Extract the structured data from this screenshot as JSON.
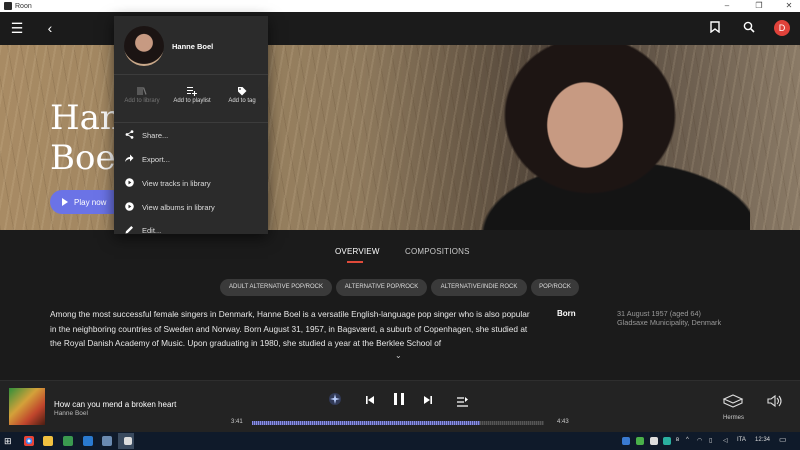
{
  "window": {
    "title": "Roon",
    "controls": [
      "–",
      "❐",
      "✕"
    ]
  },
  "appbar": {
    "menu_icon": "hamburger-icon",
    "back_icon": "chevron-left-icon",
    "bookmark_icon": "bookmark-icon",
    "search_icon": "search-icon",
    "profile_initial": "D",
    "profile_color": "#e0423a"
  },
  "hero": {
    "artist_name": "Hanne Boel",
    "play_label": "Play now",
    "accent": "#6b73e6"
  },
  "tabs": [
    {
      "label": "OVERVIEW",
      "active": true
    },
    {
      "label": "COMPOSITIONS",
      "active": false
    }
  ],
  "genres": [
    "ADULT ALTERNATIVE POP/ROCK",
    "ALTERNATIVE POP/ROCK",
    "ALTERNATIVE/INDIE ROCK",
    "POP/ROCK"
  ],
  "bio": "Among the most successful female singers in Denmark, Hanne Boel is a versatile English-language pop singer who is also popular in the neighboring countries of Sweden and Norway. Born August 31, 1957, in Bagsværd, a suburb of Copenhagen, she studied at the Royal Danish Academy of Music. Upon graduating in 1980, she studied a year at the Berklee School of",
  "born": {
    "label": "Born",
    "date": "31 August 1957 (aged 64)",
    "place": "Gladsaxe Municipality, Denmark"
  },
  "player": {
    "track_title": "How can you mend a broken heart",
    "track_artist": "Hanne Boel",
    "time_current": "3:41",
    "time_total": "4:43",
    "progress_fraction": 0.78,
    "zone_name": "Hermes"
  },
  "context_menu": {
    "artist_name": "Hanne Boel",
    "quick_actions": [
      {
        "label": "Add to library",
        "icon": "library-icon",
        "enabled": false
      },
      {
        "label": "Add to playlist",
        "icon": "playlist-add-icon",
        "enabled": true
      },
      {
        "label": "Add to tag",
        "icon": "tag-icon",
        "enabled": true
      }
    ],
    "items": [
      {
        "label": "Share...",
        "icon": "share-icon"
      },
      {
        "label": "Export...",
        "icon": "export-icon"
      },
      {
        "label": "View tracks in library",
        "icon": "play-circle-icon"
      },
      {
        "label": "View albums in library",
        "icon": "play-circle-icon"
      },
      {
        "label": "Edit...",
        "icon": "pencil-icon"
      }
    ]
  },
  "taskbar": {
    "language": "ITA",
    "clock": "12:34"
  }
}
